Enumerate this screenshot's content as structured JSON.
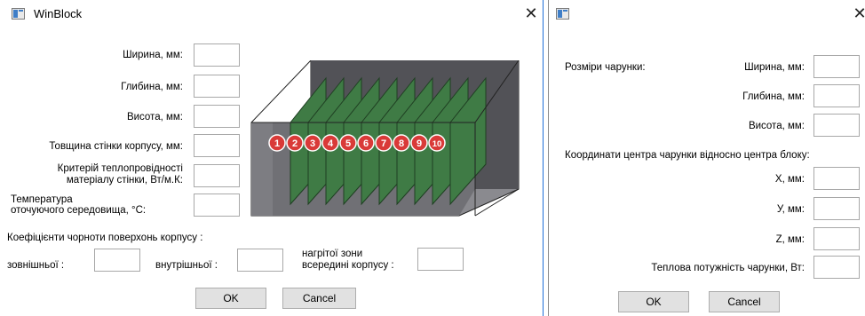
{
  "block_dialog": {
    "title": "WinBlock",
    "close_glyph": "✕",
    "labels": {
      "width": "Ширина, мм:",
      "depth": "Глибина, мм:",
      "height": "Висота, мм:",
      "wall_thickness": "Товщина стінки корпусу, мм:",
      "conductivity_1": "Критерій теплопровідності",
      "conductivity_2": "матеріалу стінки, Вт/м.К:",
      "ambient_1": "Температура",
      "ambient_2": "оточуючого середовища, °C:",
      "blackness_header": "Коефіцієнти чорноти поверхонь корпусу :",
      "outer": "зовнішньої :",
      "inner": "внутрішньої :",
      "heated_1": "нагрітої зони",
      "heated_2": "всередині корпусу :"
    },
    "values": {
      "width": "",
      "depth": "",
      "height": "",
      "wall_thickness": "",
      "conductivity": "",
      "ambient": "",
      "outer": "",
      "inner": "",
      "heated": ""
    },
    "board_numbers": [
      "1",
      "2",
      "3",
      "4",
      "5",
      "6",
      "7",
      "8",
      "9",
      "10"
    ],
    "ok_label": "OK",
    "cancel_label": "Cancel",
    "colors": {
      "board": "#3f7b45",
      "marker": "#d93a38",
      "case_outer": "#6f6f74",
      "case_inner": "#8a8a8f"
    }
  },
  "board_dialog": {
    "title": "",
    "close_glyph": "✕",
    "labels": {
      "section_size": "Розміри чарунки:",
      "width": "Ширина, мм:",
      "depth": "Глибина, мм:",
      "height": "Висота, мм:",
      "section_coords": "Координати центра чарунки відносно центра блоку:",
      "x": "X, мм:",
      "y": "У, мм:",
      "z": "Z, мм:",
      "power": "Теплова потужність чарунки, Вт:"
    },
    "values": {
      "width": "",
      "depth": "",
      "height": "",
      "x": "",
      "y": "",
      "z": "",
      "power": ""
    },
    "ok_label": "OK",
    "cancel_label": "Cancel"
  }
}
